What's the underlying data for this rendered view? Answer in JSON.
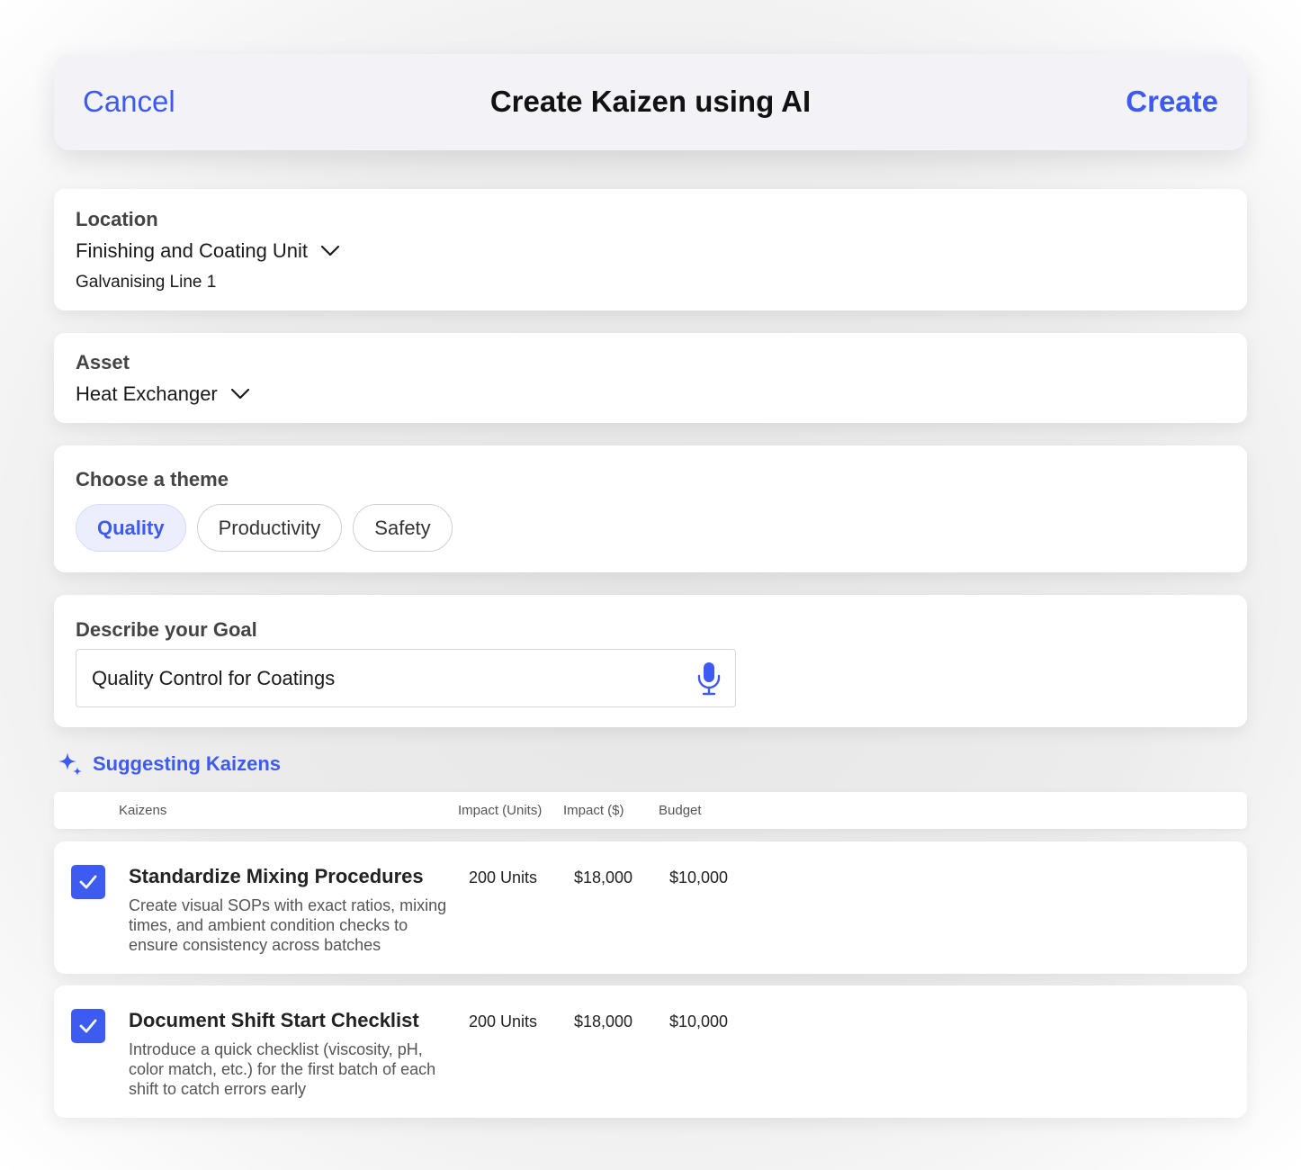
{
  "header": {
    "cancel_label": "Cancel",
    "title": "Create Kaizen using AI",
    "create_label": "Create"
  },
  "location": {
    "label": "Location",
    "selected": "Finishing and Coating Unit",
    "sub": "Galvanising Line 1"
  },
  "asset": {
    "label": "Asset",
    "selected": "Heat Exchanger"
  },
  "theme": {
    "label": "Choose a theme",
    "options": [
      "Quality",
      "Productivity",
      "Safety"
    ],
    "selected": "Quality"
  },
  "goal": {
    "label": "Describe your Goal",
    "value": "Quality Control for Coatings"
  },
  "suggestions": {
    "label": "Suggesting Kaizens",
    "columns": [
      "Kaizens",
      "Impact (Units)",
      "Impact ($)",
      "Budget"
    ],
    "rows": [
      {
        "title": "Standardize Mixing Procedures",
        "description": "Create visual SOPs with exact ratios, mixing times, and ambient condition checks to ensure consistency across batches",
        "impact_units": "200 Units",
        "impact_dollars": "$18,000",
        "budget": "$10,000",
        "checked": true
      },
      {
        "title": "Document Shift Start Checklist",
        "description": "Introduce a quick checklist (viscosity, pH, color match, etc.) for the first batch of each shift to catch errors early",
        "impact_units": "200 Units",
        "impact_dollars": "$18,000",
        "budget": "$10,000",
        "checked": true
      }
    ]
  },
  "colors": {
    "accent": "#3d5af1",
    "chip_active_bg": "#eceefd",
    "navbar_bg": "#f2f2f7"
  },
  "icons": {
    "dropdown": "chevron-down-icon",
    "mic": "microphone-icon",
    "sparkle": "sparkle-icon",
    "check": "checkmark-icon"
  }
}
